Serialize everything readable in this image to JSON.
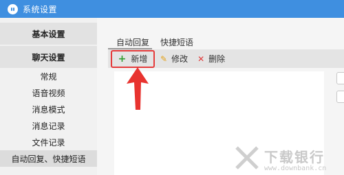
{
  "window": {
    "title": "系统设置"
  },
  "sidebar": {
    "sections": [
      {
        "label": "基本设置"
      },
      {
        "label": "聊天设置"
      }
    ],
    "items": [
      {
        "label": "常规"
      },
      {
        "label": "语音视频"
      },
      {
        "label": "消息模式"
      },
      {
        "label": "消息记录"
      },
      {
        "label": "文件记录"
      },
      {
        "label": "自动回复、快捷短语",
        "active": true
      }
    ]
  },
  "tabs": [
    {
      "label": "自动回复",
      "active": true
    },
    {
      "label": "快捷短语"
    }
  ],
  "toolbar": {
    "add_label": "新增",
    "edit_label": "修改",
    "delete_label": "删除"
  },
  "icons": {
    "add": "plus-icon",
    "edit": "pencil-icon",
    "delete": "x-icon"
  },
  "colors": {
    "titlebar": "#3f8fe0",
    "highlight": "#e53a3a",
    "add_icon": "#2f9d2f",
    "edit_icon": "#e3a21a",
    "delete_icon": "#e03a3a"
  },
  "watermark": {
    "text": "下载银行",
    "url": "www.downbank.cn"
  }
}
